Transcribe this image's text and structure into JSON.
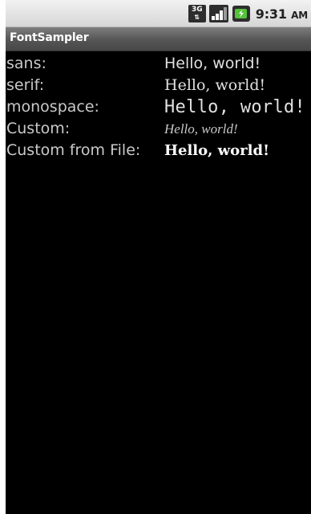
{
  "status_bar": {
    "network_label": "3G",
    "time": "9:31",
    "ampm": "AM"
  },
  "app": {
    "title": "FontSampler"
  },
  "rows": [
    {
      "label": "sans:",
      "sample": "Hello, world!"
    },
    {
      "label": "serif:",
      "sample": "Hello, world!"
    },
    {
      "label": "monospace:",
      "sample": "Hello, world!"
    },
    {
      "label": "Custom:",
      "sample": "Hello, world!"
    },
    {
      "label": "Custom from File:",
      "sample": "Hello, world!"
    }
  ],
  "colors": {
    "background": "#000000",
    "label_text": "#c9c9c9",
    "sample_text": "#e0e0e0",
    "title_bar": "#555555",
    "status_bar": "#e0e0e0"
  }
}
